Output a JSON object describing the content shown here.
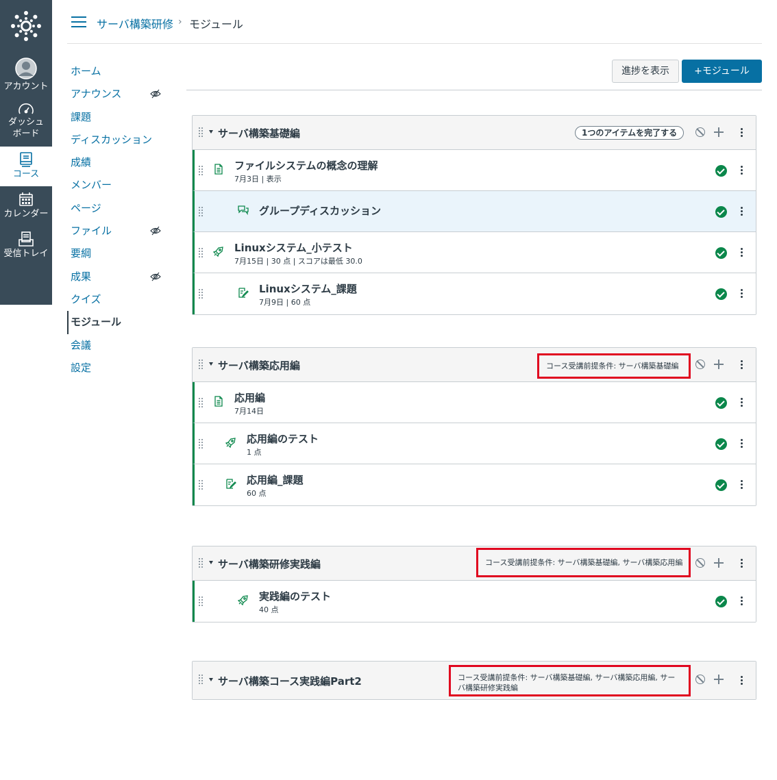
{
  "global_nav": {
    "items": [
      {
        "label": "アカウント",
        "icon": "account-icon"
      },
      {
        "label": "ダッシュ\nボード",
        "icon": "dashboard-icon"
      },
      {
        "label": "コース",
        "icon": "courses-icon"
      },
      {
        "label": "カレンダー",
        "icon": "calendar-icon"
      },
      {
        "label": "受信トレイ",
        "icon": "inbox-icon"
      }
    ]
  },
  "breadcrumb": {
    "course": "サーバ構築研修",
    "separator": "›",
    "current": "モジュール"
  },
  "course_nav": {
    "items": [
      {
        "label": "ホーム"
      },
      {
        "label": "アナウンス",
        "hidden": true
      },
      {
        "label": "課題"
      },
      {
        "label": "ディスカッション"
      },
      {
        "label": "成績"
      },
      {
        "label": "メンバー"
      },
      {
        "label": "ページ"
      },
      {
        "label": "ファイル",
        "hidden": true
      },
      {
        "label": "要綱"
      },
      {
        "label": "成果",
        "hidden": true
      },
      {
        "label": "クイズ"
      },
      {
        "label": "モジュール",
        "active": true
      },
      {
        "label": "会議"
      },
      {
        "label": "設定"
      }
    ]
  },
  "toolbar": {
    "progress_label": "進捗を表示",
    "add_module_label": "+モジュール"
  },
  "modules": [
    {
      "title": "サーバ構築基礎編",
      "requirement": "1つのアイテムを完了する",
      "prerequisite": "",
      "items": [
        {
          "title": "ファイルシステムの概念の理解",
          "meta": "7月3日 | 表示",
          "type": "page",
          "completed": true
        },
        {
          "title": "グループディスカッション",
          "meta": "",
          "type": "discussion",
          "completed": true
        },
        {
          "title": "Linuxシステム_小テスト",
          "meta": "7月15日 | 30 点 | スコアは最低 30.0",
          "type": "quiz",
          "completed": true
        },
        {
          "title": "Linuxシステム_課題",
          "meta": "7月9日 | 60 点",
          "type": "assignment",
          "completed": true
        }
      ]
    },
    {
      "title": "サーバ構築応用編",
      "requirement": "",
      "prerequisite": "コース受講前提条件: サーバ構築基礎編",
      "items": [
        {
          "title": "応用編",
          "meta": "7月14日",
          "type": "page",
          "completed": true
        },
        {
          "title": "応用編のテスト",
          "meta": "1 点",
          "type": "quiz",
          "completed": true
        },
        {
          "title": "応用編_課題",
          "meta": "60 点",
          "type": "assignment",
          "completed": true
        }
      ]
    },
    {
      "title": "サーバ構築研修実践編",
      "requirement": "",
      "prerequisite": "コース受講前提条件: サーバ構築基礎編, サーバ構築応用編",
      "items": [
        {
          "title": "実践編のテスト",
          "meta": "40 点",
          "type": "quiz",
          "completed": true
        }
      ]
    },
    {
      "title": "サーバ構築コース実践編Part2",
      "requirement": "",
      "prerequisite_line1": "コース受講前提条件: サーバ構築基礎編, サーバ構築応用編, サー",
      "prerequisite_line2": "バ構築研修実践編",
      "items": []
    }
  ],
  "colors": {
    "nav_bg": "#394b58",
    "link": "#0770a3",
    "success": "#0b874b",
    "highlight_box": "#e0061f"
  }
}
